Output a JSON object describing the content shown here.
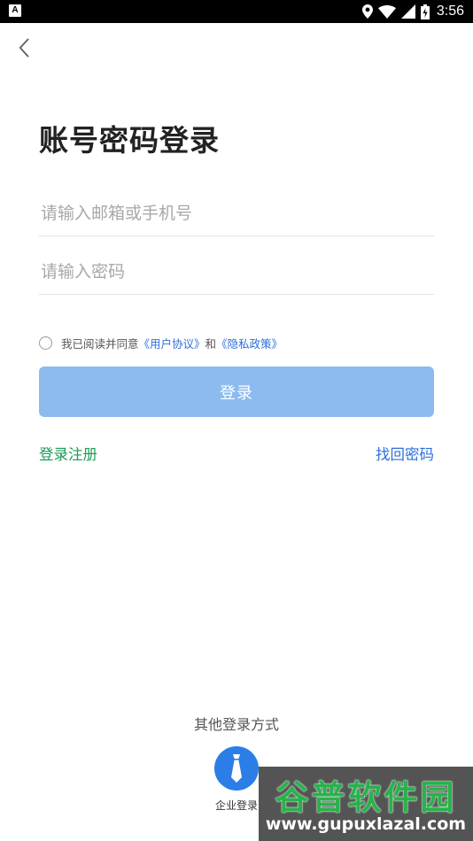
{
  "status_bar": {
    "app_icon": "A",
    "time": "3:56",
    "icons": [
      "location-icon",
      "wifi-icon",
      "signal-icon",
      "battery-icon"
    ]
  },
  "nav": {
    "back_icon": "chevron-left-icon"
  },
  "title": "账号密码登录",
  "form": {
    "email_placeholder": "请输入邮箱或手机号",
    "email_value": "",
    "password_placeholder": "请输入密码",
    "password_value": ""
  },
  "agreement": {
    "prefix": "我已阅读并同意",
    "user_agreement": "《用户协议》",
    "conjunction": "和",
    "privacy_policy": "《隐私政策》",
    "checked": false
  },
  "login_button": "登录",
  "links": {
    "register": "登录注册",
    "forgot_password": "找回密码"
  },
  "other_login": {
    "title": "其他登录方式",
    "enterprise_label": "企业登录"
  },
  "watermark": {
    "title": "谷普软件园",
    "url": "www.gupuxlazal.com"
  },
  "colors": {
    "primary_button": "#8bbbef",
    "link_blue": "#2d6fd8",
    "link_green": "#1a9a57",
    "enterprise_icon_bg": "#2b7ee6"
  }
}
